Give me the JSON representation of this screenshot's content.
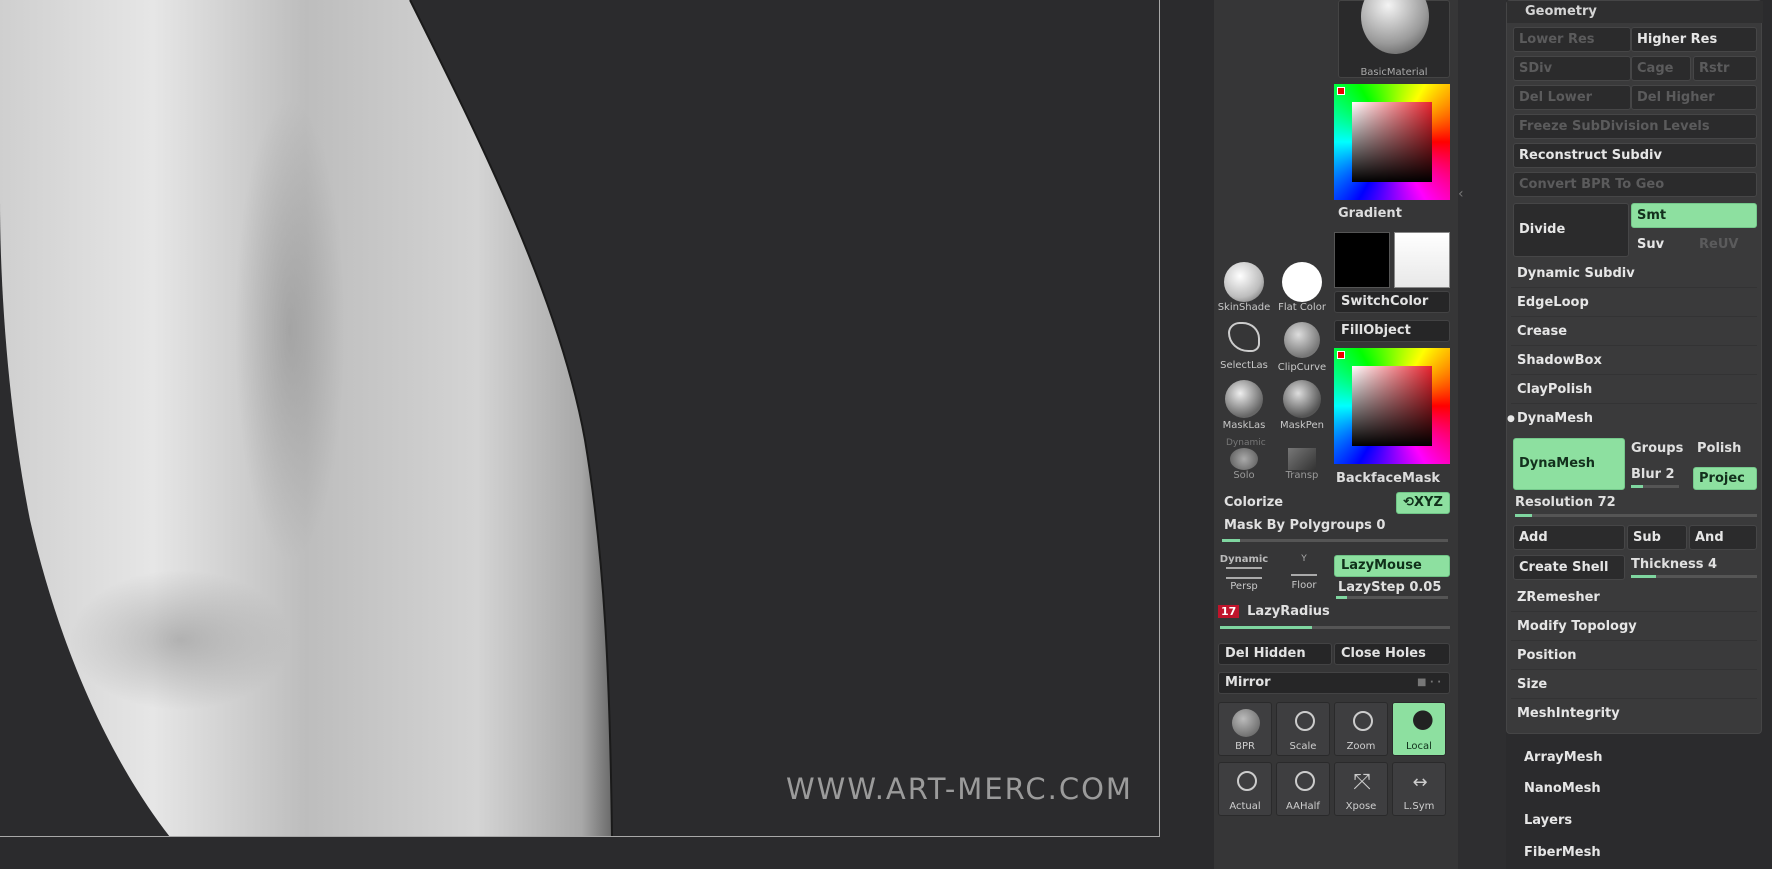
{
  "viewport": {
    "watermark": "WWW.ART-MERC.COM"
  },
  "shelf": {
    "material_label": "BasicMaterial",
    "gradient_label": "Gradient",
    "switch_color_label": "SwitchColor",
    "fill_object_label": "FillObject",
    "backface_mask_label": "BackfaceMask",
    "skinshade_label": "SkinShade",
    "flat_color_label": "Flat  Color",
    "selectlasso_label": "SelectLas",
    "clipcurve_label": "ClipCurve",
    "masklasso_label": "MaskLas",
    "maskpen_label": "MaskPen",
    "dynamic_label": "Dynamic",
    "solo_label": "Solo",
    "transp_label": "Transp",
    "colorize_label": "Colorize",
    "xyz_label": "XYZ",
    "mask_polygroups_label": "Mask By Polygroups 0",
    "persp_dynamic_label": "Dynamic",
    "persp_label": "Persp",
    "floor_label": "Floor",
    "floor_axis": "Y",
    "lazymouse_label": "LazyMouse",
    "lazystep_label": "LazyStep 0.05",
    "lazyradius_value": "17",
    "lazyradius_label": "LazyRadius",
    "del_hidden_label": "Del Hidden",
    "close_holes_label": "Close Holes",
    "mirror_label": "Mirror",
    "bpr_label": "BPR",
    "scale_label": "Scale",
    "zoom_label": "Zoom",
    "local_label": "Local",
    "actual_label": "Actual",
    "aahalf_label": "AAHalf",
    "xpose_label": "Xpose",
    "lsym_label": "L.Sym",
    "mask_polygroups_fill": 0.08,
    "lazystep_fill": 0.1,
    "lazyradius_fill": 0.4
  },
  "geometry": {
    "header": "Geometry",
    "lower_res": "Lower Res",
    "higher_res": "Higher Res",
    "sdiv": "SDiv",
    "cage": "Cage",
    "rstr": "Rstr",
    "del_lower": "Del Lower",
    "del_higher": "Del Higher",
    "freeze_subdivision": "Freeze SubDivision Levels",
    "reconstruct_subdiv": "Reconstruct Subdiv",
    "convert_bpr": "Convert BPR To Geo",
    "divide": "Divide",
    "smt": "Smt",
    "suv": "Suv",
    "reuv": "ReUV",
    "dynamic_subdiv": "Dynamic Subdiv",
    "edgeloop": "EdgeLoop",
    "crease": "Crease",
    "shadowbox": "ShadowBox",
    "claypolish": "ClayPolish",
    "dynamesh_section": "DynaMesh",
    "dynamesh_button": "DynaMesh",
    "groups": "Groups",
    "polish": "Polish",
    "blur": "Blur 2",
    "project": "Projec",
    "resolution": "Resolution 72",
    "resolution_fill": 0.07,
    "blur_fill": 0.25,
    "add": "Add",
    "sub": "Sub",
    "and": "And",
    "create_shell": "Create Shell",
    "thickness": "Thickness 4",
    "thickness_fill": 0.2,
    "zremesher": "ZRemesher",
    "modify_topology": "Modify Topology",
    "position": "Position",
    "size": "Size",
    "meshintegrity": "MeshIntegrity"
  },
  "subpalettes": {
    "arraymesh": "ArrayMesh",
    "nanomesh": "NanoMesh",
    "layers": "Layers",
    "fibermesh": "FiberMesh"
  }
}
